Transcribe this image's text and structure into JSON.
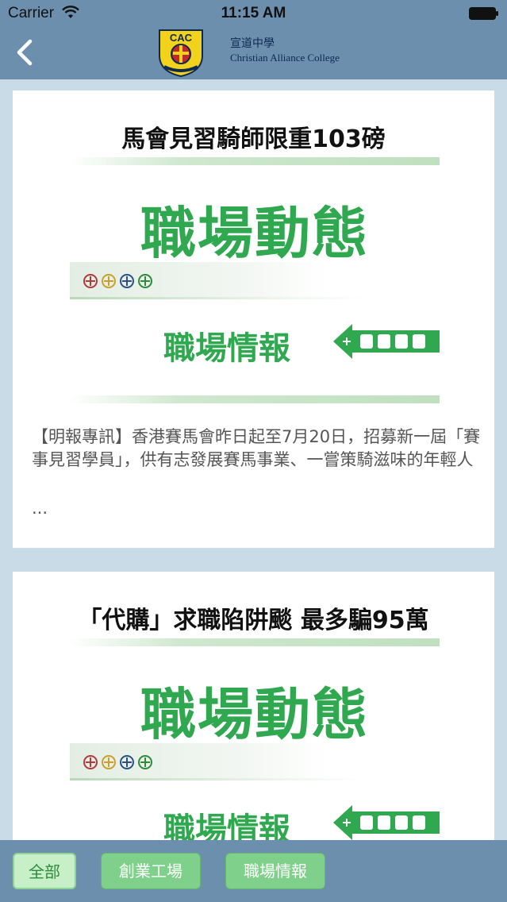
{
  "status_bar": {
    "carrier": "Carrier",
    "time": "11:15 AM"
  },
  "nav": {
    "logo_text": "CAC",
    "logo_cn": "宣道中學",
    "logo_en": "Christian Alliance College"
  },
  "banner": {
    "heading": "職場動態",
    "sub": "職場情報"
  },
  "articles": [
    {
      "title": "馬會見習騎師限重103磅",
      "desc": "【明報專訊】香港賽馬會昨日起至7月20日，招募新一屆「賽事見習學員」，供有志發展賽馬事業、一嘗策騎滋味的年輕人",
      "ellipsis": "..."
    },
    {
      "title": "「代購」求職陷阱颷 最多騙95萬"
    }
  ],
  "tabs": [
    {
      "label": "全部",
      "active": true
    },
    {
      "label": "創業工場",
      "active": false
    },
    {
      "label": "職場情報",
      "active": false
    }
  ],
  "colors": {
    "bar": "#6d8fae",
    "background": "#c9dbe6",
    "accent_green": "#2fa84f",
    "tab_green": "#7fd08a"
  }
}
